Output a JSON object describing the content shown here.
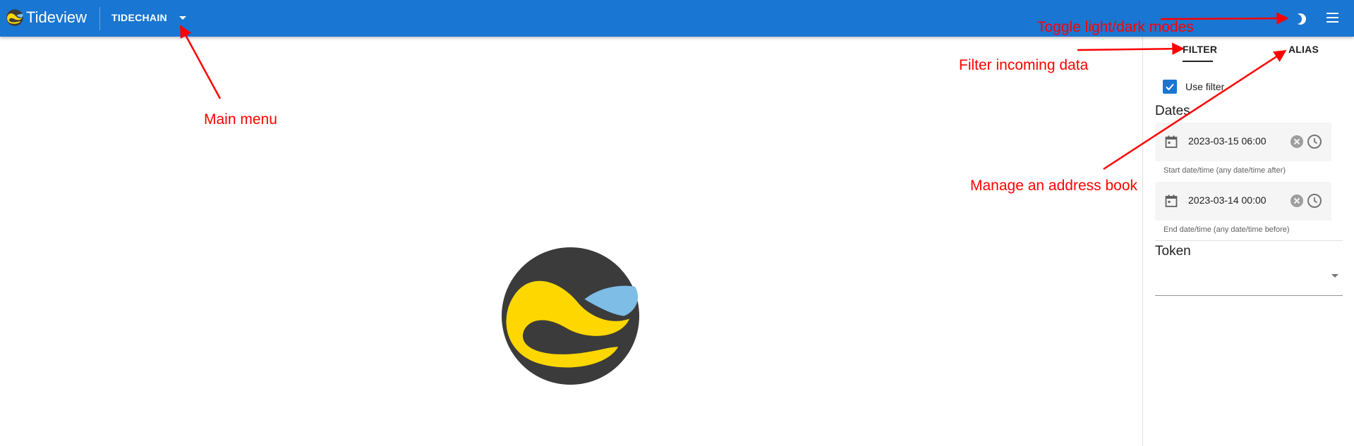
{
  "header": {
    "app_title": "Tideview",
    "chain_selector": "TIDECHAIN",
    "icons": [
      "tideview-logo-icon",
      "caret-down-icon",
      "moon-icon",
      "menu-icon"
    ]
  },
  "panel": {
    "tabs": [
      {
        "label": "FILTER",
        "active": true
      },
      {
        "label": "ALIAS",
        "active": false
      }
    ],
    "use_filter": {
      "label": "Use filter",
      "checked": true
    },
    "dates_title": "Dates",
    "start": {
      "value": "2023-03-15 06:00",
      "hint": "Start date/time (any date/time after)"
    },
    "end": {
      "value": "2023-03-14 00:00",
      "hint": "End date/time (any date/time before)"
    },
    "token_title": "Token",
    "token_value": ""
  },
  "annotations": {
    "main_menu": "Main menu",
    "toggle_modes": "Toggle light/dark modes",
    "filter_data": "Filter incoming data",
    "address_book": "Manage an address book"
  },
  "colors": {
    "appbar": "#1976d2",
    "annotation": "#ff0000",
    "logo_dark": "#3b3b3b",
    "logo_yellow": "#ffd700",
    "logo_blue": "#7dbde6"
  }
}
